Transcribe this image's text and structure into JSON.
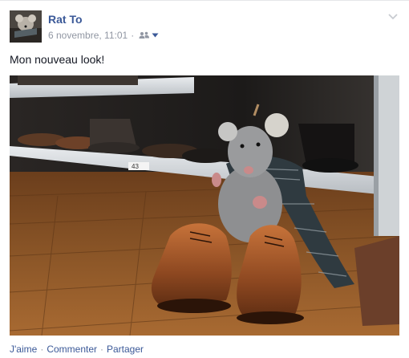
{
  "post": {
    "author": "Rat To",
    "date": "6 novembre, 11:01",
    "date_separator": "·",
    "message": "Mon nouveau look!",
    "audience_icon": "friends-icon",
    "menu_icon": "chevron-down-icon"
  },
  "actions": {
    "like": "J'aime",
    "comment": "Commenter",
    "share": "Partager",
    "separator": "·"
  },
  "photo": {
    "shelf_label": "43"
  },
  "colors": {
    "link": "#3b5998",
    "meta": "#9197a3",
    "text": "#141823"
  }
}
